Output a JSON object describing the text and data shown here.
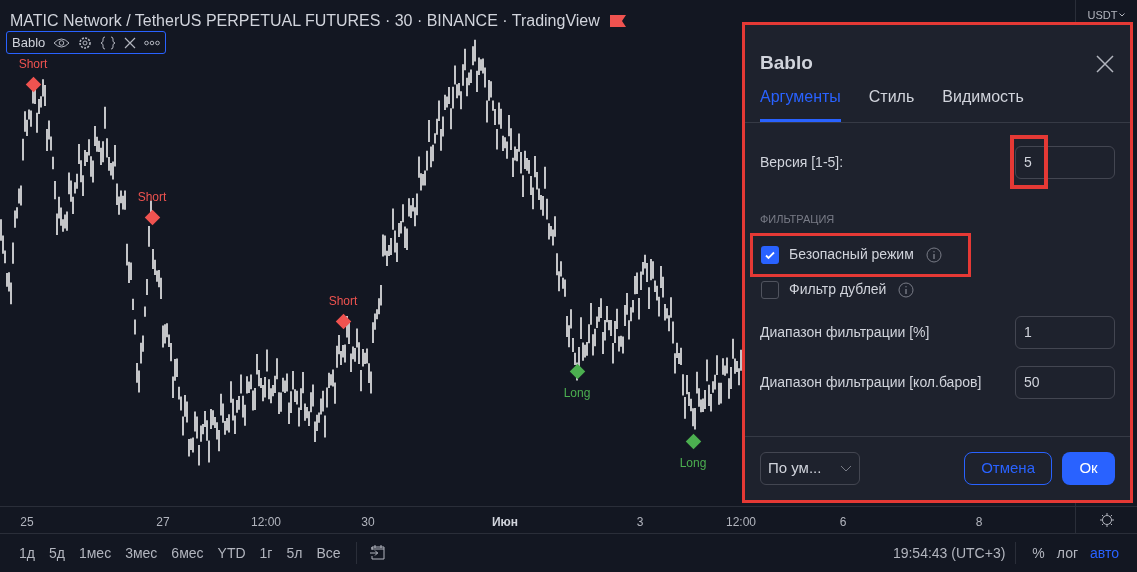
{
  "header": {
    "title": "MATIC Network / TetherUS PERPETUAL FUTURES · 30 · BINANCE · TradingView"
  },
  "indicator_legend": {
    "name": "Bablo"
  },
  "currency": {
    "label": "USDT"
  },
  "signals": [
    {
      "kind": "short",
      "label": "Short"
    },
    {
      "kind": "short",
      "label": "Short"
    },
    {
      "kind": "short",
      "label": "Short"
    },
    {
      "kind": "long",
      "label": "Long"
    },
    {
      "kind": "long",
      "label": "Long"
    }
  ],
  "time_axis": {
    "ticks": [
      {
        "label": "25",
        "kind": "day"
      },
      {
        "label": "27",
        "kind": "day"
      },
      {
        "label": "12:00",
        "kind": "time"
      },
      {
        "label": "30",
        "kind": "day"
      },
      {
        "label": "Июн",
        "kind": "month"
      },
      {
        "label": "3",
        "kind": "day"
      },
      {
        "label": "12:00",
        "kind": "time"
      },
      {
        "label": "6",
        "kind": "day"
      },
      {
        "label": "8",
        "kind": "day"
      }
    ]
  },
  "range_buttons": [
    "1д",
    "5д",
    "1мес",
    "3мес",
    "6мес",
    "YTD",
    "1г",
    "5л",
    "Все"
  ],
  "clock": "19:54:43 (UTC+3)",
  "scale_options": [
    {
      "label": "%",
      "selected": false
    },
    {
      "label": "лог",
      "selected": false
    },
    {
      "label": "авто",
      "selected": true
    }
  ],
  "dialog": {
    "title": "Bablo",
    "tabs": [
      {
        "label": "Аргументы",
        "selected": true
      },
      {
        "label": "Стиль",
        "selected": false
      },
      {
        "label": "Видимость",
        "selected": false
      }
    ],
    "rows": [
      {
        "kind": "input",
        "label": "Версия [1-5]:",
        "value": "5",
        "highlighted": true
      },
      {
        "kind": "section",
        "label": "ФИЛЬТРАЦИЯ"
      },
      {
        "kind": "checkbox",
        "label": "Безопасный режим",
        "checked": true,
        "highlighted": true
      },
      {
        "kind": "checkbox",
        "label": "Фильтр дублей",
        "checked": false,
        "highlighted": false
      },
      {
        "kind": "input",
        "label": "Диапазон фильтрации [%]",
        "value": "1",
        "highlighted": false
      },
      {
        "kind": "input",
        "label": "Диапазон фильтрации [кол.баров]",
        "value": "50",
        "highlighted": false
      }
    ],
    "preset": "По ум...",
    "cancel": "Отмена",
    "ok": "Ок"
  }
}
